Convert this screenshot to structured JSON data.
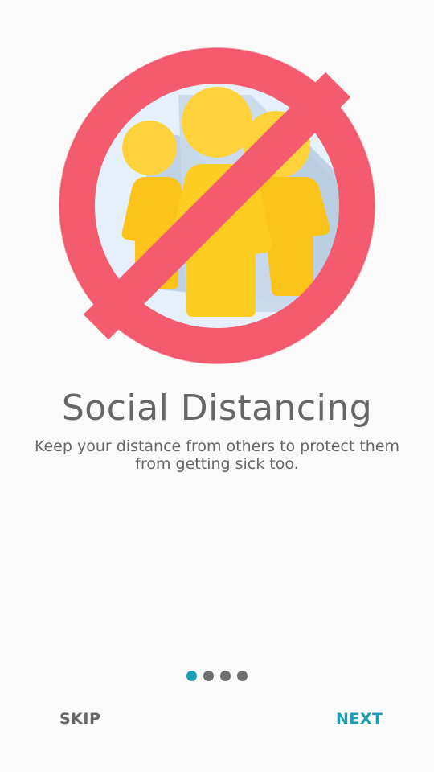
{
  "onboarding": {
    "illustration_icon": "no-crowds-icon",
    "title": "Social Distancing",
    "description": "Keep your distance from others to protect them from getting sick too.",
    "pager": {
      "total": 4,
      "current": 1
    },
    "skip_label": "SKIP",
    "next_label": "NEXT"
  },
  "colors": {
    "background": "#fafafa",
    "text": "#666666",
    "accent": "#1b9db4",
    "prohibition_red": "#f45b6f",
    "figure_yellow": "#fcc41b"
  }
}
